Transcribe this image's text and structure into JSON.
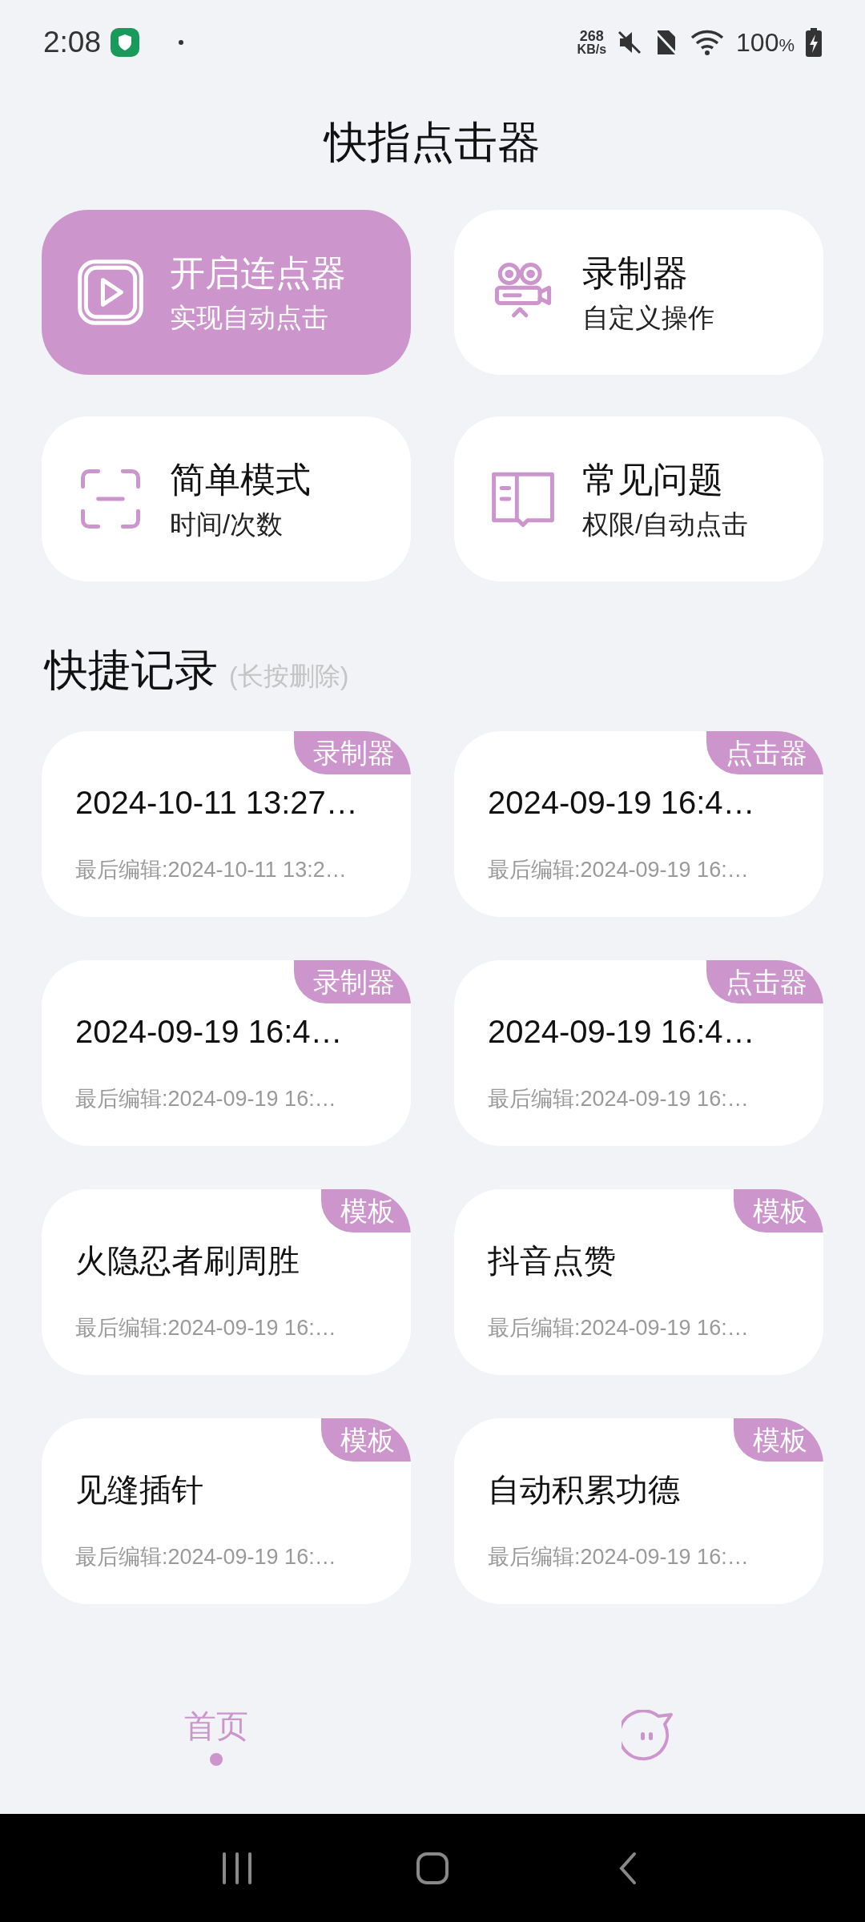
{
  "status_bar": {
    "time": "2:08",
    "speed_value": "268",
    "speed_unit": "KB/s",
    "battery": "100",
    "battery_unit": "%"
  },
  "title": "快指点击器",
  "features": [
    {
      "kind": "play",
      "title": "开启连点器",
      "subtitle": "实现自动点击",
      "highlighted": true
    },
    {
      "kind": "recorder",
      "title": "录制器",
      "subtitle": "自定义操作",
      "highlighted": false
    },
    {
      "kind": "scan",
      "title": "简单模式",
      "subtitle": "时间/次数",
      "highlighted": false
    },
    {
      "kind": "book",
      "title": "常见问题",
      "subtitle": "权限/自动点击",
      "highlighted": false
    }
  ],
  "records_section": {
    "title": "快捷记录",
    "hint": "(长按删除)"
  },
  "records": [
    {
      "tag": "录制器",
      "title": "2024-10-11 13:27…",
      "subtitle": "最后编辑:2024-10-11 13:2…"
    },
    {
      "tag": "点击器",
      "title": "2024-09-19 16:4…",
      "subtitle": "最后编辑:2024-09-19 16:…"
    },
    {
      "tag": "录制器",
      "title": "2024-09-19 16:4…",
      "subtitle": "最后编辑:2024-09-19 16:…"
    },
    {
      "tag": "点击器",
      "title": "2024-09-19 16:4…",
      "subtitle": "最后编辑:2024-09-19 16:…"
    },
    {
      "tag": "模板",
      "title": "火隐忍者刷周胜",
      "subtitle": "最后编辑:2024-09-19 16:…"
    },
    {
      "tag": "模板",
      "title": "抖音点赞",
      "subtitle": "最后编辑:2024-09-19 16:…"
    },
    {
      "tag": "模板",
      "title": "见缝插针",
      "subtitle": "最后编辑:2024-09-19 16:…"
    },
    {
      "tag": "模板",
      "title": "自动积累功德",
      "subtitle": "最后编辑:2024-09-19 16:…"
    }
  ],
  "bottom_nav": [
    {
      "kind": "text",
      "label": "首页",
      "selected": true
    },
    {
      "kind": "icon",
      "selected": false
    }
  ]
}
